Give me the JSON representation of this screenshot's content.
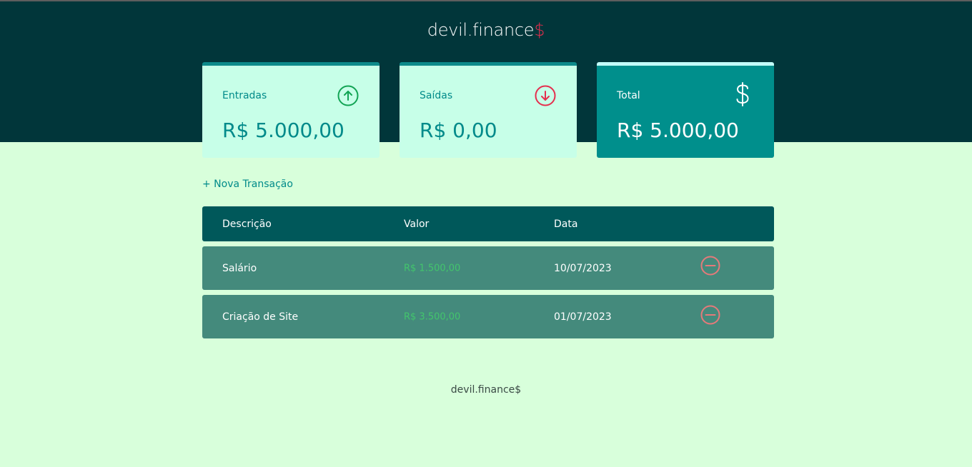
{
  "header": {
    "logo_text": "devil.finance",
    "logo_symbol": "$"
  },
  "cards": [
    {
      "label": "Entradas",
      "amount": "R$ 5.000,00",
      "icon": "arrow-up-circle-icon",
      "icon_color": "#12a454"
    },
    {
      "label": "Saídas",
      "amount": "R$ 0,00",
      "icon": "arrow-down-circle-icon",
      "icon_color": "#e52e4d"
    },
    {
      "label": "Total",
      "amount": "R$ 5.000,00",
      "icon": "dollar-icon",
      "icon_color": "#ffffff"
    }
  ],
  "actions": {
    "new_transaction": "+ Nova Transação"
  },
  "table": {
    "headers": [
      "Descrição",
      "Valor",
      "Data"
    ],
    "rows": [
      {
        "description": "Salário",
        "amount": "R$ 1.500,00",
        "date": "10/07/2023"
      },
      {
        "description": "Criação de Site",
        "amount": "R$ 3.500,00",
        "date": "01/07/2023"
      }
    ]
  },
  "footer": {
    "text": "devil.finance$"
  },
  "colors": {
    "header_bg": "#01363a",
    "page_bg": "#d8ffdb",
    "accent": "#018a8a",
    "income": "#12a454",
    "expense": "#e52e4d",
    "remove": "#e57a7a"
  }
}
